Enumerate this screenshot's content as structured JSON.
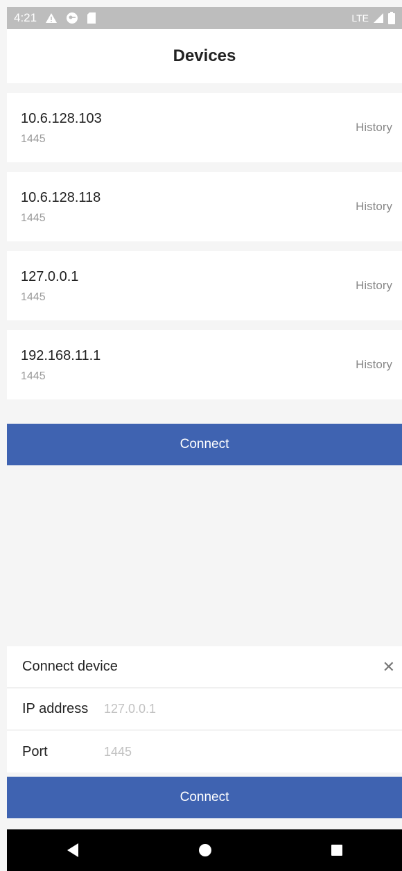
{
  "status_bar": {
    "time": "4:21",
    "network": "LTE"
  },
  "header": {
    "title": "Devices"
  },
  "devices": [
    {
      "ip": "10.6.128.103",
      "port": "1445",
      "action": "History"
    },
    {
      "ip": "10.6.128.118",
      "port": "1445",
      "action": "History"
    },
    {
      "ip": "127.0.0.1",
      "port": "1445",
      "action": "History"
    },
    {
      "ip": "192.168.11.1",
      "port": "1445",
      "action": "History"
    }
  ],
  "connect_button": {
    "label": "Connect"
  },
  "connect_panel": {
    "title": "Connect device",
    "ip_label": "IP address",
    "ip_value": "127.0.0.1",
    "port_label": "Port",
    "port_value": "1445",
    "submit_label": "Connect"
  },
  "icons": {
    "warning": "warning-icon",
    "vpn": "vpn-key-icon",
    "sd": "sd-card-icon",
    "signal": "signal-icon",
    "battery": "battery-icon",
    "close": "close-icon",
    "back": "back-triangle-icon",
    "home": "home-circle-icon",
    "recents": "recents-square-icon"
  },
  "colors": {
    "accent": "#3f63b1",
    "status_bar": "#bdbdbd",
    "nav_bar": "#000000"
  }
}
